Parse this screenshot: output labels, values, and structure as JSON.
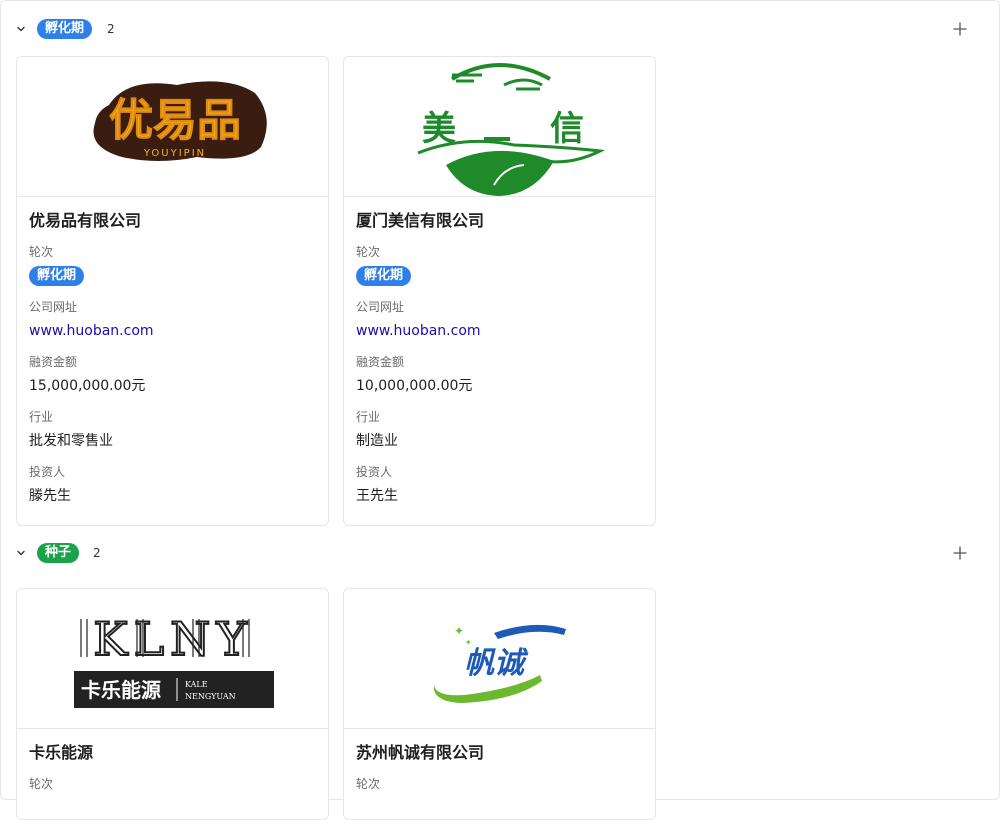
{
  "colors": {
    "incubation": "#2f7fe8",
    "seed": "#1aa34a",
    "link": "#1a0dab"
  },
  "groups": [
    {
      "tag": "孵化期",
      "count": "2",
      "cards": [
        {
          "logo": "优易品",
          "logo_sub": "YOUYIPIN",
          "title": "优易品有限公司",
          "round_label": "轮次",
          "round": "孵化期",
          "website_label": "公司网址",
          "website": "www.huoban.com",
          "amount_label": "融资金额",
          "amount": "15,000,000.00元",
          "industry_label": "行业",
          "industry": "批发和零售业",
          "investor_label": "投资人",
          "investor": "滕先生"
        },
        {
          "logo_left": "美",
          "logo_right": "信",
          "title": "厦门美信有限公司",
          "round_label": "轮次",
          "round": "孵化期",
          "website_label": "公司网址",
          "website": "www.huoban.com",
          "amount_label": "融资金额",
          "amount": "10,000,000.00元",
          "industry_label": "行业",
          "industry": "制造业",
          "investor_label": "投资人",
          "investor": "王先生"
        }
      ]
    },
    {
      "tag": "种子",
      "count": "2",
      "cards": [
        {
          "logo": "KLNY",
          "logo_cn": "卡乐能源",
          "logo_en1": "KALE",
          "logo_en2": "NENGYUAN",
          "title": "卡乐能源",
          "round_label": "轮次"
        },
        {
          "logo": "帆诚",
          "title": "苏州帆诚有限公司",
          "round_label": "轮次"
        }
      ]
    }
  ]
}
